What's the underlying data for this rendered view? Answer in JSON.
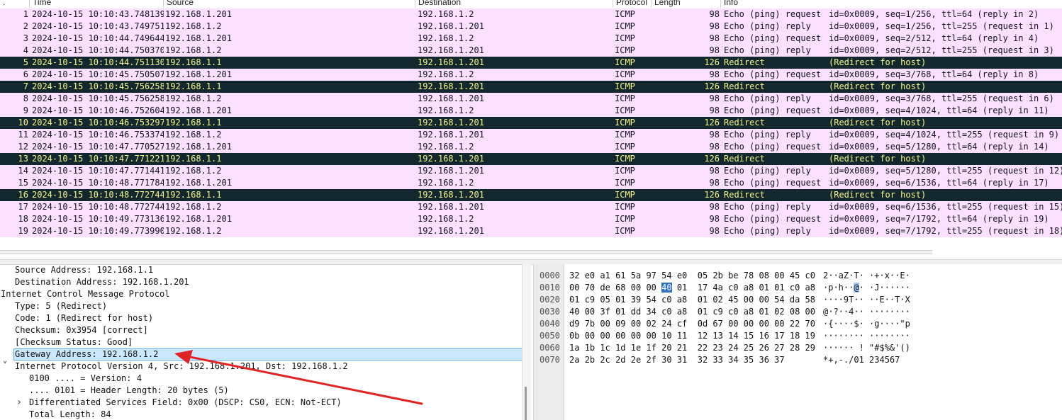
{
  "packet_list": {
    "columns": {
      "no": ".",
      "time": "Time",
      "source": "Source",
      "destination": "Destination",
      "protocol": "Protocol",
      "length": "Length",
      "info": "Info"
    },
    "rows": [
      {
        "no": "1",
        "time": "2024-10-15 10:10:43.748139",
        "src": "192.168.1.201",
        "dst": "192.168.1.2",
        "proto": "ICMP",
        "len": "98",
        "info_type": "Echo (ping) request",
        "info_detail": "id=0x0009, seq=1/256, ttl=64 (reply in 2)",
        "kind": "icmp"
      },
      {
        "no": "2",
        "time": "2024-10-15 10:10:43.749751",
        "src": "192.168.1.2",
        "dst": "192.168.1.201",
        "proto": "ICMP",
        "len": "98",
        "info_type": "Echo (ping) reply",
        "info_detail": "id=0x0009, seq=1/256, ttl=255 (request in 1)",
        "kind": "icmp"
      },
      {
        "no": "3",
        "time": "2024-10-15 10:10:44.749644",
        "src": "192.168.1.201",
        "dst": "192.168.1.2",
        "proto": "ICMP",
        "len": "98",
        "info_type": "Echo (ping) request",
        "info_detail": "id=0x0009, seq=2/512, ttl=64 (reply in 4)",
        "kind": "icmp"
      },
      {
        "no": "4",
        "time": "2024-10-15 10:10:44.750370",
        "src": "192.168.1.2",
        "dst": "192.168.1.201",
        "proto": "ICMP",
        "len": "98",
        "info_type": "Echo (ping) reply",
        "info_detail": "id=0x0009, seq=2/512, ttl=255 (request in 3)",
        "kind": "icmp"
      },
      {
        "no": "5",
        "time": "2024-10-15 10:10:44.751130",
        "src": "192.168.1.1",
        "dst": "192.168.1.201",
        "proto": "ICMP",
        "len": "126",
        "info_type": "Redirect",
        "info_detail": "(Redirect for host)",
        "kind": "redir"
      },
      {
        "no": "6",
        "time": "2024-10-15 10:10:45.750507",
        "src": "192.168.1.201",
        "dst": "192.168.1.2",
        "proto": "ICMP",
        "len": "98",
        "info_type": "Echo (ping) request",
        "info_detail": "id=0x0009, seq=3/768, ttl=64 (reply in 8)",
        "kind": "icmp"
      },
      {
        "no": "7",
        "time": "2024-10-15 10:10:45.756258",
        "src": "192.168.1.1",
        "dst": "192.168.1.201",
        "proto": "ICMP",
        "len": "126",
        "info_type": "Redirect",
        "info_detail": "(Redirect for host)",
        "kind": "redir"
      },
      {
        "no": "8",
        "time": "2024-10-15 10:10:45.756258",
        "src": "192.168.1.2",
        "dst": "192.168.1.201",
        "proto": "ICMP",
        "len": "98",
        "info_type": "Echo (ping) reply",
        "info_detail": "id=0x0009, seq=3/768, ttl=255 (request in 6)",
        "kind": "icmp"
      },
      {
        "no": "9",
        "time": "2024-10-15 10:10:46.752604",
        "src": "192.168.1.201",
        "dst": "192.168.1.2",
        "proto": "ICMP",
        "len": "98",
        "info_type": "Echo (ping) request",
        "info_detail": "id=0x0009, seq=4/1024, ttl=64 (reply in 11)",
        "kind": "icmp"
      },
      {
        "no": "10",
        "time": "2024-10-15 10:10:46.753297",
        "src": "192.168.1.1",
        "dst": "192.168.1.201",
        "proto": "ICMP",
        "len": "126",
        "info_type": "Redirect",
        "info_detail": "(Redirect for host)",
        "kind": "redir"
      },
      {
        "no": "11",
        "time": "2024-10-15 10:10:46.753374",
        "src": "192.168.1.2",
        "dst": "192.168.1.201",
        "proto": "ICMP",
        "len": "98",
        "info_type": "Echo (ping) reply",
        "info_detail": "id=0x0009, seq=4/1024, ttl=255 (request in 9)",
        "kind": "icmp"
      },
      {
        "no": "12",
        "time": "2024-10-15 10:10:47.770527",
        "src": "192.168.1.201",
        "dst": "192.168.1.2",
        "proto": "ICMP",
        "len": "98",
        "info_type": "Echo (ping) request",
        "info_detail": "id=0x0009, seq=5/1280, ttl=64 (reply in 14)",
        "kind": "icmp"
      },
      {
        "no": "13",
        "time": "2024-10-15 10:10:47.771221",
        "src": "192.168.1.1",
        "dst": "192.168.1.201",
        "proto": "ICMP",
        "len": "126",
        "info_type": "Redirect",
        "info_detail": "(Redirect for host)",
        "kind": "redir"
      },
      {
        "no": "14",
        "time": "2024-10-15 10:10:47.771441",
        "src": "192.168.1.2",
        "dst": "192.168.1.201",
        "proto": "ICMP",
        "len": "98",
        "info_type": "Echo (ping) reply",
        "info_detail": "id=0x0009, seq=5/1280, ttl=255 (request in 12)",
        "kind": "icmp"
      },
      {
        "no": "15",
        "time": "2024-10-15 10:10:48.771784",
        "src": "192.168.1.201",
        "dst": "192.168.1.2",
        "proto": "ICMP",
        "len": "98",
        "info_type": "Echo (ping) request",
        "info_detail": "id=0x0009, seq=6/1536, ttl=64 (reply in 17)",
        "kind": "icmp"
      },
      {
        "no": "16",
        "time": "2024-10-15 10:10:48.772744",
        "src": "192.168.1.1",
        "dst": "192.168.1.201",
        "proto": "ICMP",
        "len": "126",
        "info_type": "Redirect",
        "info_detail": "(Redirect for host)",
        "kind": "redir"
      },
      {
        "no": "17",
        "time": "2024-10-15 10:10:48.772744",
        "src": "192.168.1.2",
        "dst": "192.168.1.201",
        "proto": "ICMP",
        "len": "98",
        "info_type": "Echo (ping) reply",
        "info_detail": "id=0x0009, seq=6/1536, ttl=255 (request in 15)",
        "kind": "icmp"
      },
      {
        "no": "18",
        "time": "2024-10-15 10:10:49.773136",
        "src": "192.168.1.201",
        "dst": "192.168.1.2",
        "proto": "ICMP",
        "len": "98",
        "info_type": "Echo (ping) request",
        "info_detail": "id=0x0009, seq=7/1792, ttl=64 (reply in 19)",
        "kind": "icmp"
      },
      {
        "no": "19",
        "time": "2024-10-15 10:10:49.773990",
        "src": "192.168.1.2",
        "dst": "192.168.1.201",
        "proto": "ICMP",
        "len": "98",
        "info_type": "Echo (ping) reply",
        "info_detail": "id=0x0009, seq=7/1792, ttl=255 (request in 18)",
        "kind": "icmp"
      }
    ]
  },
  "details": [
    {
      "text": "Source Address: 192.168.1.1",
      "indent": 1,
      "arrow": "",
      "selected": false
    },
    {
      "text": "Destination Address: 192.168.1.201",
      "indent": 1,
      "arrow": "",
      "selected": false
    },
    {
      "text": "Internet Control Message Protocol",
      "indent": 0,
      "arrow": "",
      "selected": false
    },
    {
      "text": "Type: 5 (Redirect)",
      "indent": 1,
      "arrow": "",
      "selected": false
    },
    {
      "text": "Code: 1 (Redirect for host)",
      "indent": 1,
      "arrow": "",
      "selected": false
    },
    {
      "text": "Checksum: 0x3954 [correct]",
      "indent": 1,
      "arrow": "",
      "selected": false
    },
    {
      "text": "[Checksum Status: Good]",
      "indent": 1,
      "arrow": "",
      "selected": false
    },
    {
      "text": "Gateway Address: 192.168.1.2",
      "indent": 1,
      "arrow": "",
      "selected": true
    },
    {
      "text": "Internet Protocol Version 4, Src: 192.168.1.201, Dst: 192.168.1.2",
      "indent": 1,
      "arrow": "expanded",
      "selected": false
    },
    {
      "text": "0100 .... = Version: 4",
      "indent": 2,
      "arrow": "",
      "selected": false
    },
    {
      "text": ".... 0101 = Header Length: 20 bytes (5)",
      "indent": 2,
      "arrow": "",
      "selected": false
    },
    {
      "text": "Differentiated Services Field: 0x00 (DSCP: CS0, ECN: Not-ECT)",
      "indent": 2,
      "arrow": "collapsed",
      "selected": false
    },
    {
      "text": "Total Length: 84",
      "indent": 2,
      "arrow": "",
      "selected": false
    }
  ],
  "bytes": [
    {
      "offset": "0000",
      "hex": [
        "32",
        "e0",
        "a1",
        "61",
        "5a",
        "97",
        "54",
        "e0",
        "05",
        "2b",
        "be",
        "78",
        "08",
        "00",
        "45",
        "c0"
      ],
      "ascii": "2··aZ·T· ·+·x··E·"
    },
    {
      "offset": "0010",
      "hex": [
        "00",
        "70",
        "de",
        "68",
        "00",
        "00",
        "40",
        "01",
        "17",
        "4a",
        "c0",
        "a8",
        "01",
        "01",
        "c0",
        "a8"
      ],
      "ascii": "·p·h··@· ·J······"
    },
    {
      "offset": "0020",
      "hex": [
        "01",
        "c9",
        "05",
        "01",
        "39",
        "54",
        "c0",
        "a8",
        "01",
        "02",
        "45",
        "00",
        "00",
        "54",
        "da",
        "58"
      ],
      "ascii": "····9T·· ··E··T·X"
    },
    {
      "offset": "0030",
      "hex": [
        "40",
        "00",
        "3f",
        "01",
        "dd",
        "34",
        "c0",
        "a8",
        "01",
        "c9",
        "c0",
        "a8",
        "01",
        "02",
        "08",
        "00"
      ],
      "ascii": "@·?··4·· ········"
    },
    {
      "offset": "0040",
      "hex": [
        "d9",
        "7b",
        "00",
        "09",
        "00",
        "02",
        "24",
        "cf",
        "0d",
        "67",
        "00",
        "00",
        "00",
        "00",
        "22",
        "70"
      ],
      "ascii": "·{····$· ·g····\"p"
    },
    {
      "offset": "0050",
      "hex": [
        "0b",
        "00",
        "00",
        "00",
        "00",
        "00",
        "10",
        "11",
        "12",
        "13",
        "14",
        "15",
        "16",
        "17",
        "18",
        "19"
      ],
      "ascii": "········ ········"
    },
    {
      "offset": "0060",
      "hex": [
        "1a",
        "1b",
        "1c",
        "1d",
        "1e",
        "1f",
        "20",
        "21",
        "22",
        "23",
        "24",
        "25",
        "26",
        "27",
        "28",
        "29"
      ],
      "ascii": "······ ! \"#$%&'()"
    },
    {
      "offset": "0070",
      "hex": [
        "2a",
        "2b",
        "2c",
        "2d",
        "2e",
        "2f",
        "30",
        "31",
        "32",
        "33",
        "34",
        "35",
        "36",
        "37"
      ],
      "ascii": "*+,-./01 234567"
    }
  ],
  "bytes_highlight": {
    "row": 1,
    "hex_index": 6,
    "ascii_char": "@"
  },
  "colors": {
    "icmp_row_bg": "#fce0ff",
    "redirect_row_bg": "#12272e",
    "redirect_row_fg": "#f7f787",
    "selection_bg": "#cce8ff",
    "annotation_arrow": "#e02424"
  },
  "annotation": {
    "icon": "red-arrow-icon",
    "points_to": "Gateway Address: 192.168.1.2"
  }
}
